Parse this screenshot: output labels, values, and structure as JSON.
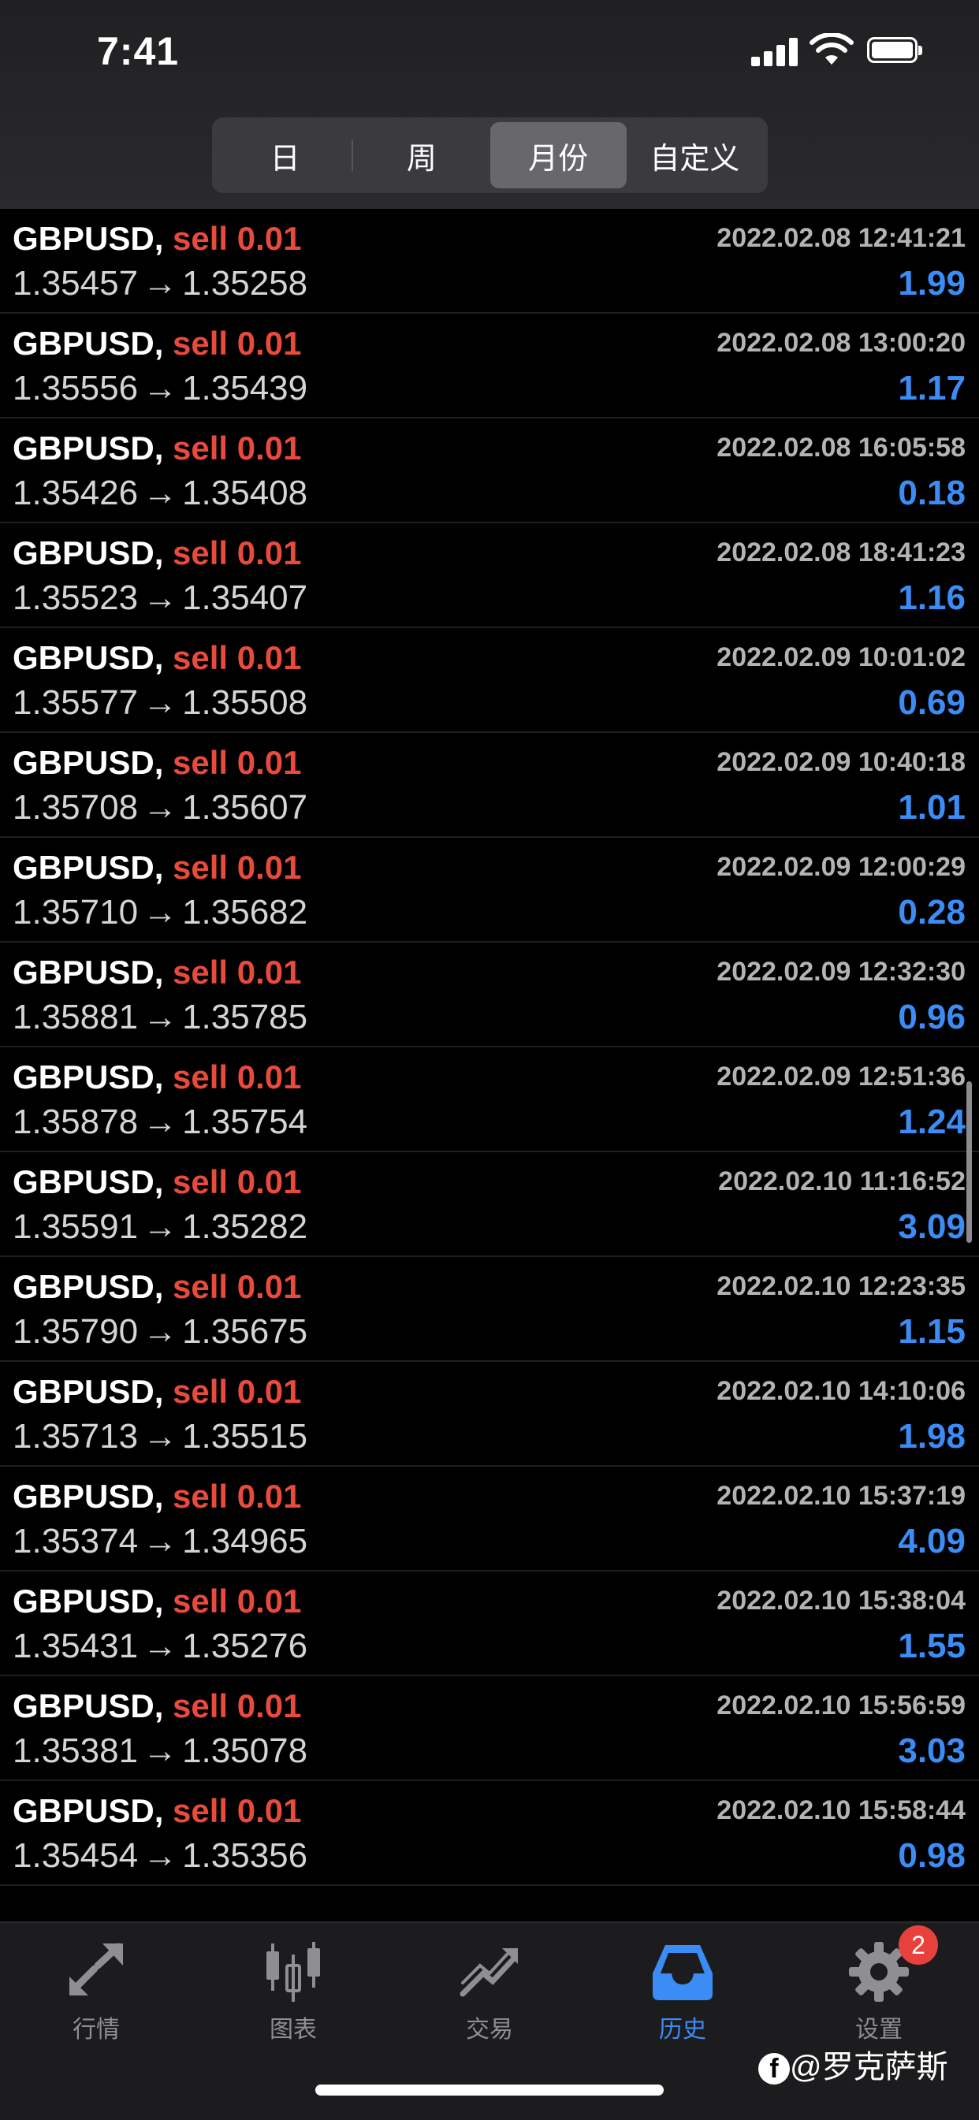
{
  "status_bar": {
    "time": "7:41"
  },
  "segments": [
    {
      "label": "日",
      "active": false
    },
    {
      "label": "周",
      "active": false
    },
    {
      "label": "月份",
      "active": true
    },
    {
      "label": "自定义",
      "active": false
    }
  ],
  "trades": [
    {
      "symbol": "GBPUSD,",
      "side": "sell 0.01",
      "date": "2022.02.08 12:41:21",
      "open": "1.35457",
      "close": "1.35258",
      "profit": "1.99"
    },
    {
      "symbol": "GBPUSD,",
      "side": "sell 0.01",
      "date": "2022.02.08 13:00:20",
      "open": "1.35556",
      "close": "1.35439",
      "profit": "1.17"
    },
    {
      "symbol": "GBPUSD,",
      "side": "sell 0.01",
      "date": "2022.02.08 16:05:58",
      "open": "1.35426",
      "close": "1.35408",
      "profit": "0.18"
    },
    {
      "symbol": "GBPUSD,",
      "side": "sell 0.01",
      "date": "2022.02.08 18:41:23",
      "open": "1.35523",
      "close": "1.35407",
      "profit": "1.16"
    },
    {
      "symbol": "GBPUSD,",
      "side": "sell 0.01",
      "date": "2022.02.09 10:01:02",
      "open": "1.35577",
      "close": "1.35508",
      "profit": "0.69"
    },
    {
      "symbol": "GBPUSD,",
      "side": "sell 0.01",
      "date": "2022.02.09 10:40:18",
      "open": "1.35708",
      "close": "1.35607",
      "profit": "1.01"
    },
    {
      "symbol": "GBPUSD,",
      "side": "sell 0.01",
      "date": "2022.02.09 12:00:29",
      "open": "1.35710",
      "close": "1.35682",
      "profit": "0.28"
    },
    {
      "symbol": "GBPUSD,",
      "side": "sell 0.01",
      "date": "2022.02.09 12:32:30",
      "open": "1.35881",
      "close": "1.35785",
      "profit": "0.96"
    },
    {
      "symbol": "GBPUSD,",
      "side": "sell 0.01",
      "date": "2022.02.09 12:51:36",
      "open": "1.35878",
      "close": "1.35754",
      "profit": "1.24"
    },
    {
      "symbol": "GBPUSD,",
      "side": "sell 0.01",
      "date": "2022.02.10 11:16:52",
      "open": "1.35591",
      "close": "1.35282",
      "profit": "3.09"
    },
    {
      "symbol": "GBPUSD,",
      "side": "sell 0.01",
      "date": "2022.02.10 12:23:35",
      "open": "1.35790",
      "close": "1.35675",
      "profit": "1.15"
    },
    {
      "symbol": "GBPUSD,",
      "side": "sell 0.01",
      "date": "2022.02.10 14:10:06",
      "open": "1.35713",
      "close": "1.35515",
      "profit": "1.98"
    },
    {
      "symbol": "GBPUSD,",
      "side": "sell 0.01",
      "date": "2022.02.10 15:37:19",
      "open": "1.35374",
      "close": "1.34965",
      "profit": "4.09"
    },
    {
      "symbol": "GBPUSD,",
      "side": "sell 0.01",
      "date": "2022.02.10 15:38:04",
      "open": "1.35431",
      "close": "1.35276",
      "profit": "1.55"
    },
    {
      "symbol": "GBPUSD,",
      "side": "sell 0.01",
      "date": "2022.02.10 15:56:59",
      "open": "1.35381",
      "close": "1.35078",
      "profit": "3.03"
    },
    {
      "symbol": "GBPUSD,",
      "side": "sell 0.01",
      "date": "2022.02.10 15:58:44",
      "open": "1.35454",
      "close": "1.35356",
      "profit": "0.98"
    }
  ],
  "price_arrow": "→",
  "tab_bar": [
    {
      "label": "行情",
      "icon": "quotes-icon",
      "active": false
    },
    {
      "label": "图表",
      "icon": "chart-icon",
      "active": false
    },
    {
      "label": "交易",
      "icon": "trade-icon",
      "active": false
    },
    {
      "label": "历史",
      "icon": "history-icon",
      "active": true
    },
    {
      "label": "设置",
      "icon": "gear-icon",
      "active": false,
      "badge": "2"
    }
  ],
  "watermark": {
    "text": "@罗克萨斯"
  },
  "colors": {
    "sell": "#e84a3c",
    "profit": "#3b8df5",
    "active_tab": "#3b8df5",
    "badge": "#e8413b"
  }
}
